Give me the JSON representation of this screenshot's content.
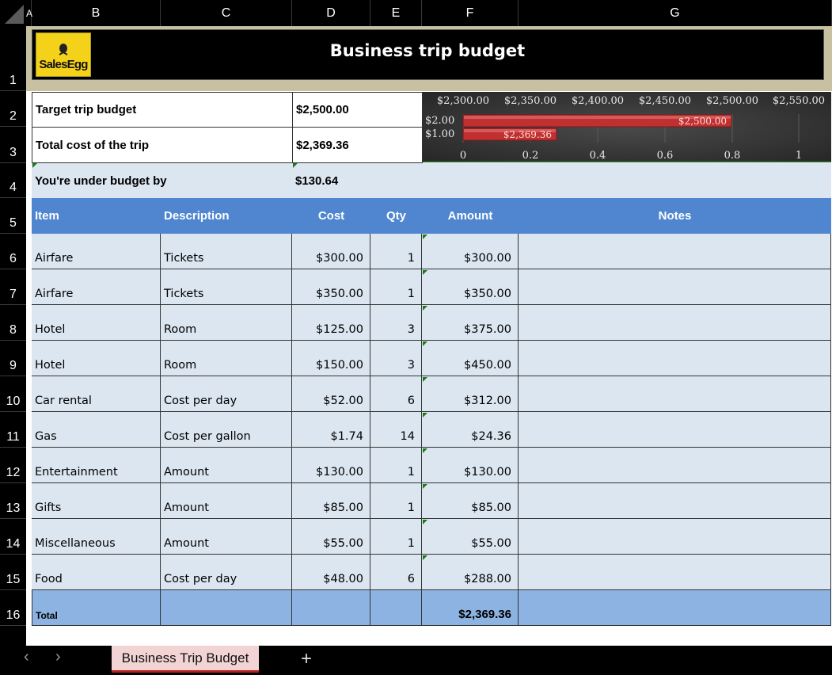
{
  "columns": [
    "A",
    "B",
    "C",
    "D",
    "E",
    "F",
    "G"
  ],
  "rows": [
    "1",
    "2",
    "3",
    "4",
    "5",
    "6",
    "7",
    "8",
    "9",
    "10",
    "11",
    "12",
    "13",
    "14",
    "15",
    "16"
  ],
  "title": "Business trip budget",
  "logo_text": "SalesEgg",
  "summary": {
    "target_label": "Target trip budget",
    "target_value": "$2,500.00",
    "total_label": "Total cost of the trip",
    "total_value": "$2,369.36",
    "under_label": "You're under budget by",
    "under_value": "$130.64"
  },
  "table": {
    "headers": [
      "Item",
      "Description",
      "Cost",
      "Qty",
      "Amount",
      "Notes"
    ],
    "rows": [
      [
        "Airfare",
        "Tickets",
        "$300.00",
        "1",
        "$300.00",
        ""
      ],
      [
        "Airfare",
        "Tickets",
        "$350.00",
        "1",
        "$350.00",
        ""
      ],
      [
        "Hotel",
        "Room",
        "$125.00",
        "3",
        "$375.00",
        ""
      ],
      [
        "Hotel",
        "Room",
        "$150.00",
        "3",
        "$450.00",
        ""
      ],
      [
        "Car rental",
        "Cost per day",
        "$52.00",
        "6",
        "$312.00",
        ""
      ],
      [
        "Gas",
        "Cost per gallon",
        "$1.74",
        "14",
        "$24.36",
        ""
      ],
      [
        "Entertainment",
        "Amount",
        "$130.00",
        "1",
        "$130.00",
        ""
      ],
      [
        "Gifts",
        "Amount",
        "$85.00",
        "1",
        "$85.00",
        ""
      ],
      [
        "Miscellaneous",
        "Amount",
        "$55.00",
        "1",
        "$55.00",
        ""
      ],
      [
        "Food",
        "Cost per day",
        "$48.00",
        "6",
        "$288.00",
        ""
      ]
    ],
    "total_label": "Total",
    "total_amount": "$2,369.36"
  },
  "chart_data": {
    "type": "bar",
    "orientation": "horizontal",
    "categories": [
      "$2.00",
      "$1.00"
    ],
    "values": [
      2500,
      2369.36
    ],
    "data_labels": [
      "$2,500.00",
      "$2,369.36"
    ],
    "top_axis_ticks": [
      "$2,300.00",
      "$2,350.00",
      "$2,400.00",
      "$2,450.00",
      "$2,500.00",
      "$2,550.00"
    ],
    "bottom_axis_ticks": [
      "0",
      "0.2",
      "0.4",
      "0.6",
      "0.8",
      "1"
    ],
    "bar_color": "#c03030",
    "grid": true
  },
  "sheet_tab": "Business Trip Budget",
  "nav": {
    "prev": "‹",
    "next": "›",
    "add": "+"
  },
  "colors": {
    "header_blue": "#4f86cf",
    "row_fill": "#dce6f0",
    "total_fill": "#8db3e2",
    "tab_active": "#f2d4d4"
  }
}
